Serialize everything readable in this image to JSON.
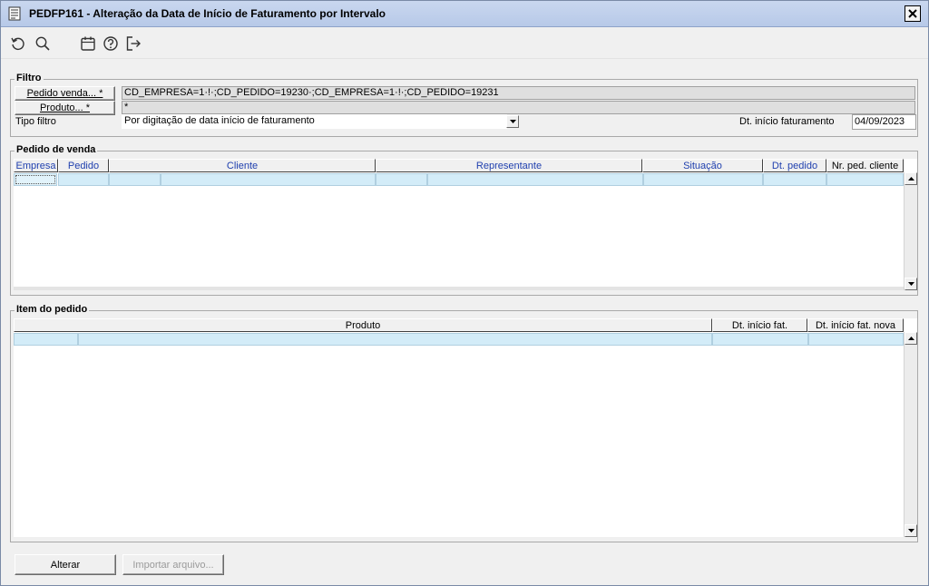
{
  "window": {
    "title": "PEDFP161 - Alteração da Data de Início de Faturamento por Intervalo"
  },
  "toolbar": {
    "icons": [
      "refresh-icon",
      "search-icon",
      "calendar-icon",
      "help-icon",
      "exit-icon"
    ]
  },
  "filtro": {
    "title": "Filtro",
    "pedido_button": "Pedido venda... *",
    "pedido_value": "CD_EMPRESA=1·!·;CD_PEDIDO=19230·;CD_EMPRESA=1·!·;CD_PEDIDO=19231",
    "produto_button": "Produto... *",
    "produto_value": "*",
    "tipo_label": "Tipo filtro",
    "tipo_value": "Por digitação de data início de faturamento",
    "dt_label": "Dt. início faturamento",
    "dt_value": "04/09/2023"
  },
  "pedido_venda": {
    "title": "Pedido de venda",
    "columns": [
      "Empresa",
      "Pedido",
      "Cliente",
      "Representante",
      "Situação",
      "Dt. pedido",
      "Nr. ped. cliente"
    ]
  },
  "item_pedido": {
    "title": "Item do pedido",
    "columns": [
      "Produto",
      "Dt. início fat.",
      "Dt. início fat. nova"
    ]
  },
  "footer": {
    "alterar_button": "Alterar",
    "importar_button": "Importar arquivo..."
  },
  "colors": {
    "titlebar": "#b7c9e8",
    "grid_row": "#d3ecf8",
    "header_text": "#1f3fae"
  }
}
